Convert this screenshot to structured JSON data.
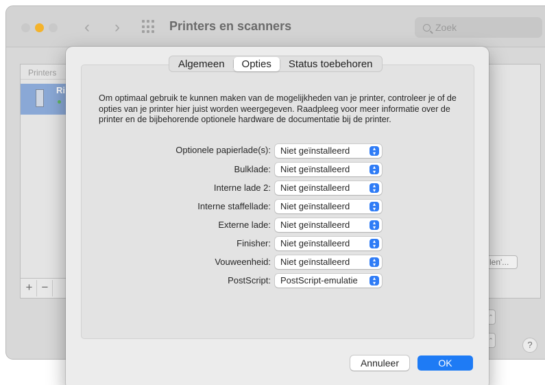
{
  "window": {
    "title": "Printers en scanners",
    "search_placeholder": "Zoek"
  },
  "printer_list": {
    "header": "Printers",
    "selected_printer_name": "Ri",
    "add_label": "+",
    "remove_label": "−"
  },
  "right_panel": {
    "open_queue_label": "len'...",
    "help_label": "?"
  },
  "sheet": {
    "tabs": [
      {
        "label": "Algemeen",
        "active": false
      },
      {
        "label": "Opties",
        "active": true
      },
      {
        "label": "Status toebehoren",
        "active": false
      }
    ],
    "intro": "Om optimaal gebruik te kunnen maken van de mogelijkheden van je printer, controleer je of de opties van je printer hier juist worden weergegeven. Raadpleeg voor meer informatie over de printer en de bijbehorende optionele hardware de documentatie bij de printer.",
    "options": [
      {
        "label": "Optionele papierlade(s):",
        "value": "Niet geïnstalleerd"
      },
      {
        "label": "Bulklade:",
        "value": "Niet geïnstalleerd"
      },
      {
        "label": "Interne lade 2:",
        "value": "Niet geïnstalleerd"
      },
      {
        "label": "Interne staffellade:",
        "value": "Niet geïnstalleerd"
      },
      {
        "label": "Externe lade:",
        "value": "Niet geïnstalleerd"
      },
      {
        "label": "Finisher:",
        "value": "Niet geïnstalleerd"
      },
      {
        "label": "Vouweenheid:",
        "value": "Niet geïnstalleerd"
      },
      {
        "label": "PostScript:",
        "value": "PostScript-emulatie"
      }
    ],
    "cancel_label": "Annuleer",
    "ok_label": "OK"
  },
  "colors": {
    "accent": "#1e7bf5",
    "selection": "#8aa8d6",
    "minimize": "#f4b32b"
  }
}
